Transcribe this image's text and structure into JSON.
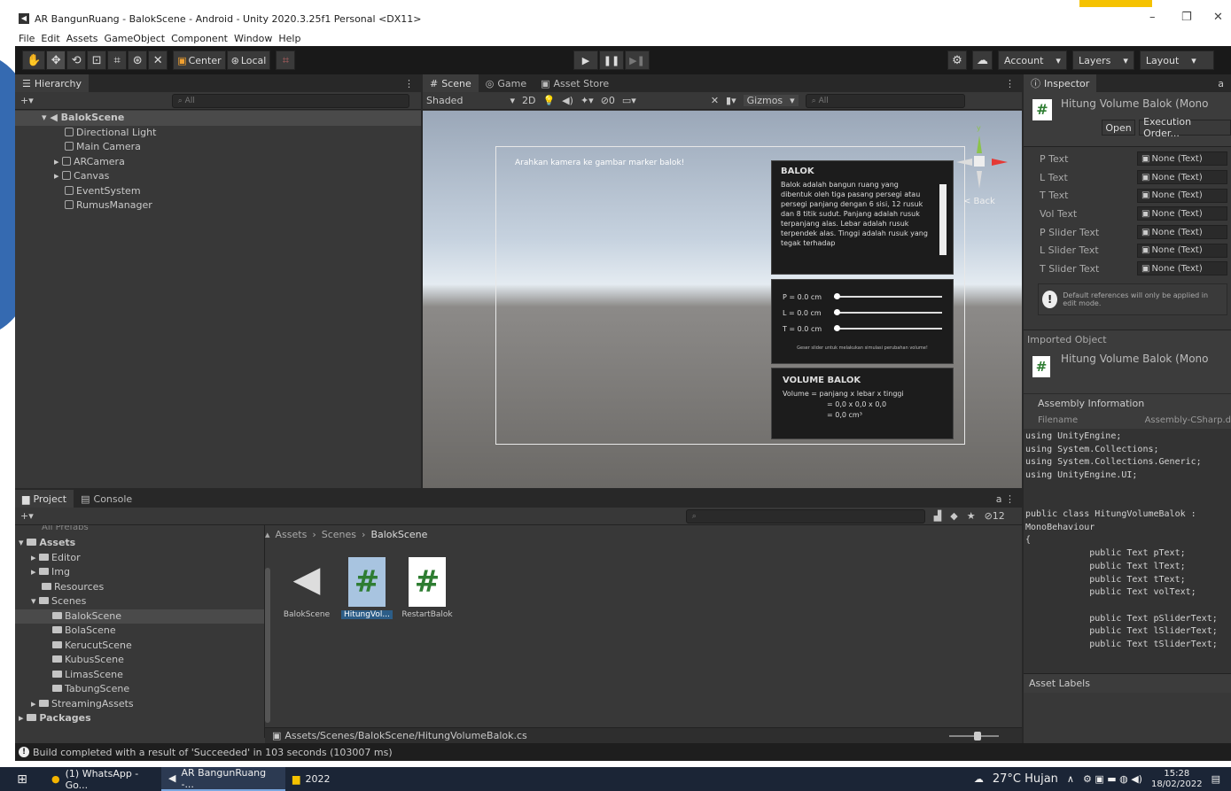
{
  "window": {
    "title": "AR BangunRuang - BalokScene - Android - Unity 2020.3.25f1 Personal <DX11>",
    "controls": {
      "minimize": "–",
      "restore": "❐",
      "close": "✕"
    }
  },
  "menu": [
    "File",
    "Edit",
    "Assets",
    "GameObject",
    "Component",
    "Window",
    "Help"
  ],
  "toolbar": {
    "center_label": "Center",
    "local_label": "Local",
    "account_label": "Account",
    "layers_label": "Layers",
    "layout_label": "Layout"
  },
  "hierarchy": {
    "tab": "Hierarchy",
    "search_placeholder": "All",
    "scene": "BalokScene",
    "items": [
      "Directional Light",
      "Main Camera",
      "ARCamera",
      "Canvas",
      "EventSystem",
      "RumusManager"
    ]
  },
  "scene_tabs": {
    "scene": "Scene",
    "game": "Game",
    "asset_store": "Asset Store"
  },
  "scene_toolbar": {
    "shading": "Shaded",
    "mode_2d": "2D",
    "hidden_count": "0",
    "gizmos": "Gizmos",
    "search_placeholder": "All"
  },
  "scene_content": {
    "instruction": "Arahkan kamera ke gambar marker balok!",
    "back_label": "< Back",
    "info_title": "BALOK",
    "info_text": "Balok adalah bangun ruang yang dibentuk oleh tiga pasang persegi atau persegi panjang dengan 6 sisi, 12 rusuk dan 8 titik sudut. Panjang adalah rusuk terpanjang alas. Lebar adalah rusuk terpendek alas. Tinggi adalah rusuk yang tegak terhadap",
    "sliders": [
      {
        "label": "P = 0.0 cm",
        "value": 0
      },
      {
        "label": "L = 0.0 cm",
        "value": 0
      },
      {
        "label": "T = 0.0 cm",
        "value": 0
      }
    ],
    "slider_note": "Geser slider untuk melakukan simulasi perubahan volume!",
    "volume_title": "VOLUME BALOK",
    "formula_line1": "Volume  =  panjang  x  lebar  x  tinggi",
    "formula_line2": "=  0,0  x  0,0  x  0,0",
    "formula_line3": "=  0,0  cm³"
  },
  "inspector": {
    "tab": "Inspector",
    "script_title": "Hitung Volume Balok (Mono",
    "open_button": "Open",
    "exec_button": "Execution Order...",
    "fields": [
      {
        "label": "P Text",
        "value": "None (Text)"
      },
      {
        "label": "L Text",
        "value": "None (Text)"
      },
      {
        "label": "T Text",
        "value": "None (Text)"
      },
      {
        "label": "Vol Text",
        "value": "None (Text)"
      },
      {
        "label": "P Slider Text",
        "value": "None (Text)"
      },
      {
        "label": "L Slider Text",
        "value": "None (Text)"
      },
      {
        "label": "T Slider Text",
        "value": "None (Text)"
      }
    ],
    "warning": "Default references will only be applied in edit mode.",
    "imported_label": "Imported Object",
    "imported_title": "Hitung Volume Balok (Mono",
    "assembly_header": "Assembly Information",
    "filename_label": "Filename",
    "filename_value": "Assembly-CSharp.d",
    "code": "using UnityEngine;\nusing System.Collections;\nusing System.Collections.Generic;\nusing UnityEngine.UI;\n\n\npublic class HitungVolumeBalok :\nMonoBehaviour\n{\n            public Text pText;\n            public Text lText;\n            public Text tText;\n            public Text volText;\n\n            public Text pSliderText;\n            public Text lSliderText;\n            public Text tSliderText;",
    "asset_labels": "Asset Labels"
  },
  "project": {
    "tab_project": "Project",
    "tab_console": "Console",
    "hidden_count": "12",
    "tree_top": "All Prefabs",
    "tree": [
      {
        "label": "Assets",
        "level": 0,
        "bold": true
      },
      {
        "label": "Editor",
        "level": 1
      },
      {
        "label": "Img",
        "level": 1
      },
      {
        "label": "Resources",
        "level": 1
      },
      {
        "label": "Scenes",
        "level": 1
      },
      {
        "label": "BalokScene",
        "level": 2,
        "selected": true
      },
      {
        "label": "BolaScene",
        "level": 2
      },
      {
        "label": "KerucutScene",
        "level": 2
      },
      {
        "label": "KubusScene",
        "level": 2
      },
      {
        "label": "LimasScene",
        "level": 2
      },
      {
        "label": "TabungScene",
        "level": 2
      },
      {
        "label": "StreamingAssets",
        "level": 1
      },
      {
        "label": "Packages",
        "level": 0,
        "bold": true
      }
    ],
    "breadcrumb": [
      "Assets",
      "Scenes",
      "BalokScene"
    ],
    "files": [
      "BalokScene",
      "HitungVol...",
      "RestartBalok"
    ],
    "path": "Assets/Scenes/BalokScene/HitungVolumeBalok.cs"
  },
  "status": "Build completed with a result of 'Succeeded' in 103 seconds (103007 ms)",
  "taskbar": {
    "apps": [
      "(1) WhatsApp - Go...",
      "AR BangunRuang -...",
      "2022"
    ],
    "weather": "27°C  Hujan",
    "time": "15:28",
    "date": "18/02/2022"
  },
  "colors": {
    "accent": "#2c5d87",
    "selection": "#2c5d87",
    "play_green": "#4caf50"
  }
}
